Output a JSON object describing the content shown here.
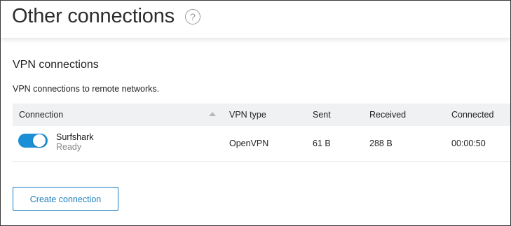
{
  "page": {
    "title": "Other connections",
    "help_icon": "question-circle-icon",
    "help_glyph": "?"
  },
  "vpn": {
    "section_title": "VPN connections",
    "description": "VPN connections to remote networks.",
    "columns": {
      "connection": "Connection",
      "vpn_type": "VPN type",
      "sent": "Sent",
      "received": "Received",
      "connected": "Connected"
    },
    "rows": [
      {
        "enabled": true,
        "name": "Surfshark",
        "status": "Ready",
        "vpn_type": "OpenVPN",
        "sent": "61 B",
        "received": "288 B",
        "connected": "00:00:50"
      }
    ],
    "create_button_label": "Create connection"
  },
  "colors": {
    "accent": "#1a8fd6",
    "button_border": "#1b7fc0",
    "header_bg": "#f0f1f2"
  }
}
